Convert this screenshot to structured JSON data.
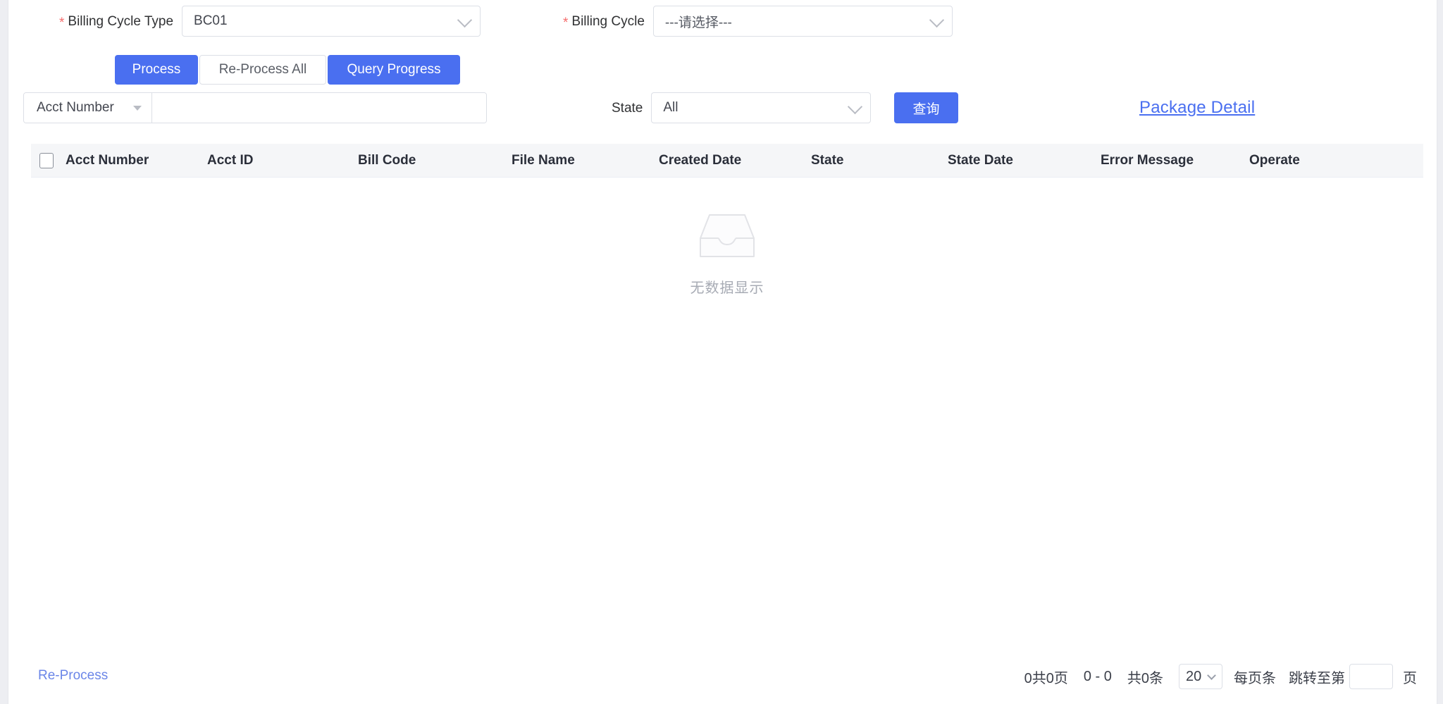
{
  "form": {
    "billing_cycle_type": {
      "label": "Billing Cycle Type",
      "required_mark": "*",
      "value": "BC01"
    },
    "billing_cycle": {
      "label": "Billing Cycle",
      "required_mark": "*",
      "value": "---请选择---"
    }
  },
  "actions": {
    "process": "Process",
    "reprocess_all": "Re-Process All",
    "query_progress": "Query Progress"
  },
  "search": {
    "field_selector": "Acct Number",
    "input_value": "",
    "input_placeholder": "",
    "state_label": "State",
    "state_value": "All",
    "query_button": "查询",
    "package_detail_link": "Package Detail"
  },
  "table": {
    "columns": [
      "Acct Number",
      "Acct ID",
      "Bill Code",
      "File Name",
      "Created Date",
      "State",
      "State Date",
      "Error Message",
      "Operate"
    ],
    "rows": [],
    "empty_text": "无数据显示",
    "empty_icon": "empty-inbox-icon"
  },
  "footer": {
    "reprocess_link": "Re-Process",
    "pagination": {
      "page_summary": "0共0页",
      "range": "0 - 0",
      "total": "共0条",
      "page_size": "20",
      "page_size_label": "每页条",
      "jump_prefix": "跳转至第",
      "jump_value": "",
      "jump_suffix": "页"
    }
  },
  "colors": {
    "primary": "#4a6ff0",
    "link": "#4a6ff0",
    "required": "#f56c6c",
    "header_bg": "#f5f6f8",
    "border": "#dcdfe6"
  }
}
